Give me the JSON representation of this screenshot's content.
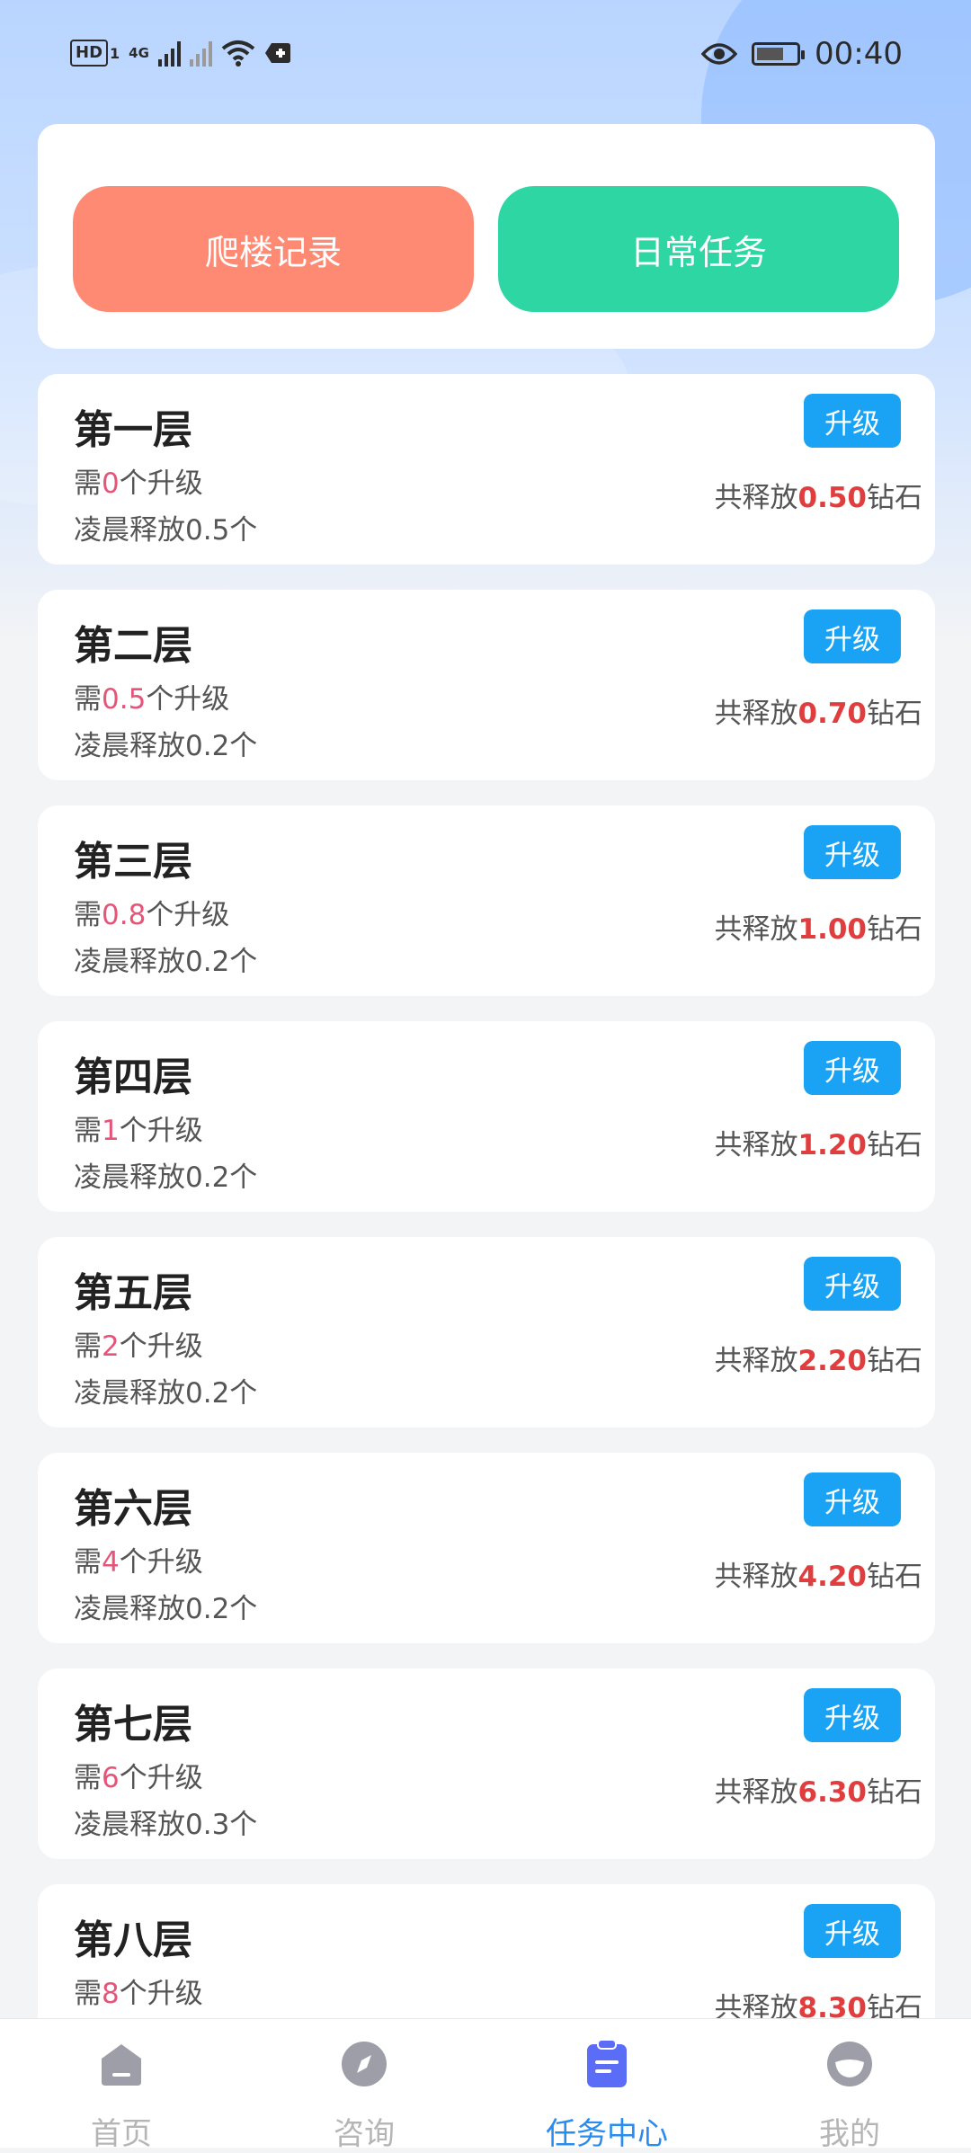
{
  "status_bar": {
    "hd": "HD",
    "sim": "1",
    "net": "4G",
    "time": "00:40"
  },
  "tabs": {
    "climb_record": "爬楼记录",
    "daily_tasks": "日常任务"
  },
  "floors": [
    {
      "title": "第一层",
      "need_prefix": "需",
      "need": "0",
      "need_suffix": "个升级",
      "release": "凌晨释放0.5个",
      "button": "升级",
      "total_prefix": "共释放",
      "total": "0.50",
      "total_suffix": "钻石"
    },
    {
      "title": "第二层",
      "need_prefix": "需",
      "need": "0.5",
      "need_suffix": "个升级",
      "release": "凌晨释放0.2个",
      "button": "升级",
      "total_prefix": "共释放",
      "total": "0.70",
      "total_suffix": "钻石"
    },
    {
      "title": "第三层",
      "need_prefix": "需",
      "need": "0.8",
      "need_suffix": "个升级",
      "release": "凌晨释放0.2个",
      "button": "升级",
      "total_prefix": "共释放",
      "total": "1.00",
      "total_suffix": "钻石"
    },
    {
      "title": "第四层",
      "need_prefix": "需",
      "need": "1",
      "need_suffix": "个升级",
      "release": "凌晨释放0.2个",
      "button": "升级",
      "total_prefix": "共释放",
      "total": "1.20",
      "total_suffix": "钻石"
    },
    {
      "title": "第五层",
      "need_prefix": "需",
      "need": "2",
      "need_suffix": "个升级",
      "release": "凌晨释放0.2个",
      "button": "升级",
      "total_prefix": "共释放",
      "total": "2.20",
      "total_suffix": "钻石"
    },
    {
      "title": "第六层",
      "need_prefix": "需",
      "need": "4",
      "need_suffix": "个升级",
      "release": "凌晨释放0.2个",
      "button": "升级",
      "total_prefix": "共释放",
      "total": "4.20",
      "total_suffix": "钻石"
    },
    {
      "title": "第七层",
      "need_prefix": "需",
      "need": "6",
      "need_suffix": "个升级",
      "release": "凌晨释放0.3个",
      "button": "升级",
      "total_prefix": "共释放",
      "total": "6.30",
      "total_suffix": "钻石"
    },
    {
      "title": "第八层",
      "need_prefix": "需",
      "need": "8",
      "need_suffix": "个升级",
      "release": "",
      "button": "升级",
      "total_prefix": "共释放",
      "total": "8.30",
      "total_suffix": "钻石"
    }
  ],
  "nav": [
    {
      "label": "首页",
      "icon": "home-icon",
      "active": false
    },
    {
      "label": "咨询",
      "icon": "compass-icon",
      "active": false
    },
    {
      "label": "任务中心",
      "icon": "clipboard-icon",
      "active": true
    },
    {
      "label": "我的",
      "icon": "profile-icon",
      "active": false
    }
  ],
  "colors": {
    "accent_blue": "#1aa3f4",
    "active_nav": "#2b8cf0",
    "climb_button": "#ff8a73",
    "daily_button": "#2ed6a4",
    "need_value": "#e5557a",
    "total_value": "#e03e3e"
  }
}
